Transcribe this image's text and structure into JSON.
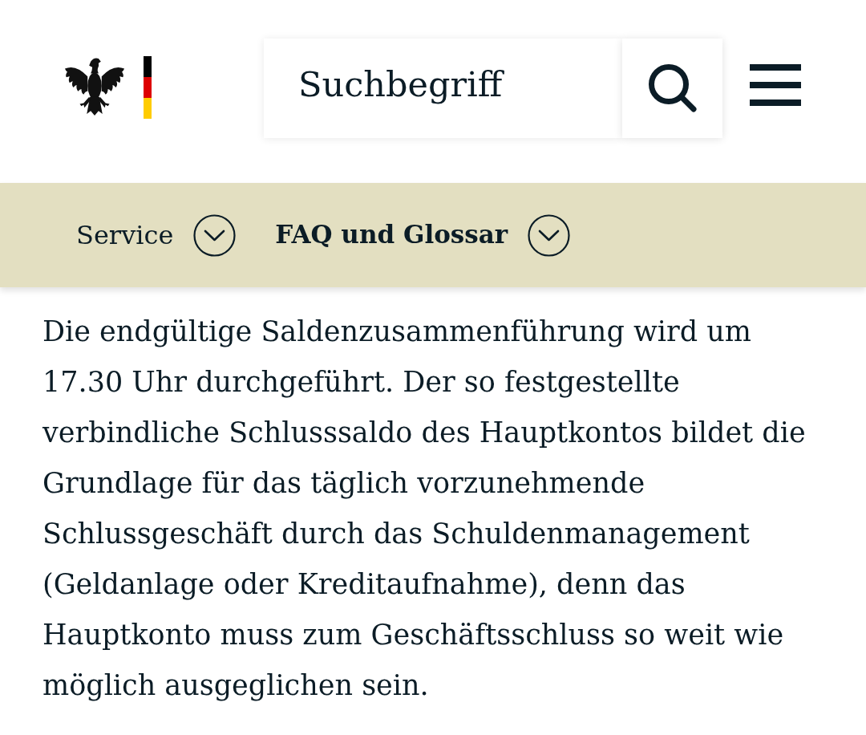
{
  "search": {
    "placeholder": "Suchbegriff"
  },
  "breadcrumb": [
    {
      "label": "Service",
      "selected": false,
      "expanded": false
    },
    {
      "label": "FAQ und Glossar",
      "selected": true,
      "expanded": false
    }
  ],
  "article": {
    "paragraph": "Die endgültige Saldenzusammenführung wird um 17.30 Uhr durchgeführt. Der so festgestellte verbindliche Schlusssaldo des Hauptkontos bildet die Grundlage für das täglich vorzunehmende Schlussgeschäft durch das Schuldenmanagement (Geldanlage oder Kreditaufnahme), denn das Hauptkonto muss zum Geschäftsschluss so weit wie möglich ausgeglichen sein."
  }
}
